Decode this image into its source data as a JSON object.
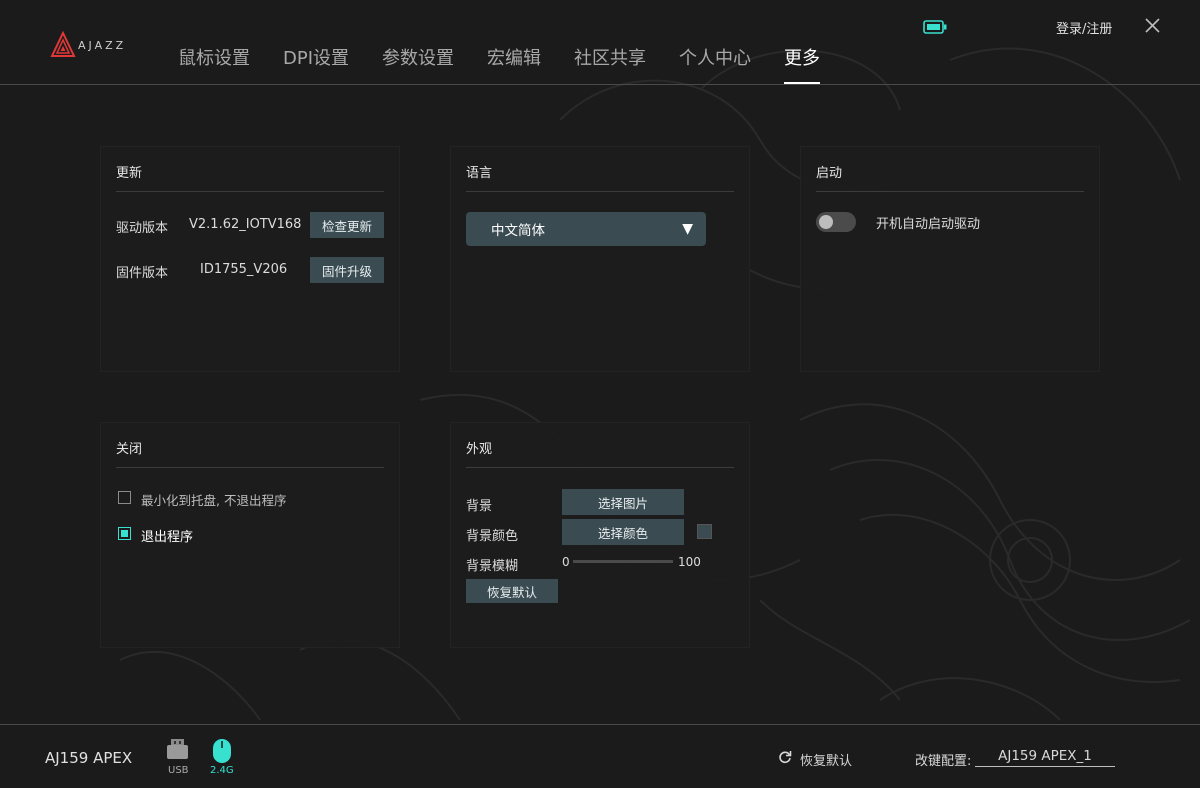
{
  "brand": {
    "logo_text": "AJAZZ"
  },
  "header": {
    "tabs": [
      {
        "label": "鼠标设置",
        "active": false
      },
      {
        "label": "DPI设置",
        "active": false
      },
      {
        "label": "参数设置",
        "active": false
      },
      {
        "label": "宏编辑",
        "active": false
      },
      {
        "label": "社区共享",
        "active": false
      },
      {
        "label": "个人中心",
        "active": false
      },
      {
        "label": "更多",
        "active": true
      }
    ],
    "login_label": "登录/注册",
    "battery_icon": "battery-icon",
    "close_icon": "close-icon"
  },
  "update_panel": {
    "title": "更新",
    "driver_label": "驱动版本",
    "driver_version": "V2.1.62_IOTV168",
    "check_update_button": "检查更新",
    "firmware_label": "固件版本",
    "firmware_version": "ID1755_V206",
    "firmware_upgrade_button": "固件升级"
  },
  "language_panel": {
    "title": "语言",
    "selected": "中文简体",
    "arrow": "▼"
  },
  "startup_panel": {
    "title": "启动",
    "autostart_label": "开机自动启动驱动",
    "autostart_enabled": false
  },
  "close_panel": {
    "title": "关闭",
    "options": [
      {
        "label": "最小化到托盘, 不退出程序",
        "checked": false
      },
      {
        "label": "退出程序",
        "checked": true
      }
    ]
  },
  "appearance_panel": {
    "title": "外观",
    "background_label": "背景",
    "choose_image_button": "选择图片",
    "background_color_label": "背景颜色",
    "choose_color_button": "选择颜色",
    "blur_label": "背景模糊",
    "blur_min": "0",
    "blur_max": "100",
    "restore_default_button": "恢复默认"
  },
  "footer": {
    "device_name": "AJ159 APEX",
    "usb_label": "USB",
    "wireless_label": "2.4G",
    "restore_default_label": "恢复默认",
    "config_label": "改键配置:",
    "config_value": "AJ159 APEX_1"
  },
  "colors": {
    "accent": "#37e0cf",
    "button_bg": "#3a4b52",
    "background": "#1b1b1b",
    "panel_bg": "#1c1c1c"
  }
}
